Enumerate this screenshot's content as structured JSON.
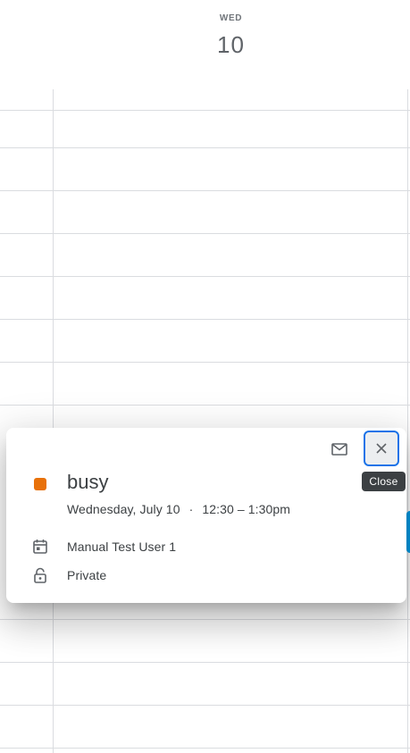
{
  "day_header": {
    "dow": "WED",
    "date": "10"
  },
  "event_popover": {
    "title": "busy",
    "date": "Wednesday, July 10",
    "separator": "·",
    "time": "12:30 – 1:30pm",
    "calendar": "Manual Test User 1",
    "visibility": "Private",
    "event_color": "#e8710a",
    "close_tooltip": "Close",
    "icons": [
      "mail-icon",
      "close-icon",
      "calendar-icon",
      "lock-icon"
    ]
  }
}
